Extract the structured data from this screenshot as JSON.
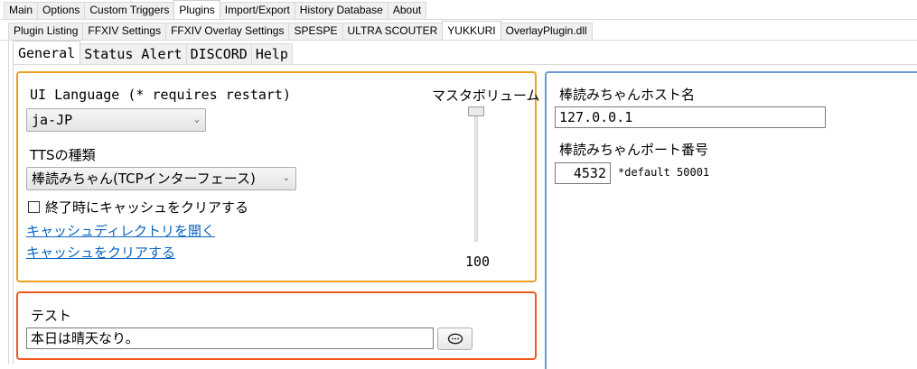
{
  "top_tabs": [
    {
      "label": "Main"
    },
    {
      "label": "Options"
    },
    {
      "label": "Custom Triggers"
    },
    {
      "label": "Plugins",
      "active": true
    },
    {
      "label": "Import/Export"
    },
    {
      "label": "History Database"
    },
    {
      "label": "About"
    }
  ],
  "plugin_tabs": [
    {
      "label": "Plugin Listing"
    },
    {
      "label": "FFXIV Settings"
    },
    {
      "label": "FFXIV Overlay Settings"
    },
    {
      "label": "SPESPE"
    },
    {
      "label": "ULTRA SCOUTER"
    },
    {
      "label": "YUKKURI",
      "active": true
    },
    {
      "label": "OverlayPlugin.dll"
    }
  ],
  "yukkuri_tabs": [
    {
      "label": "General",
      "active": true
    },
    {
      "label": "Status Alert"
    },
    {
      "label": "DISCORD"
    },
    {
      "label": "Help"
    }
  ],
  "settings": {
    "ui_language_label": "UI Language (* requires restart)",
    "ui_language_value": "ja-JP",
    "tts_label": "TTSの種類",
    "tts_value": "棒読みちゃん(TCPインターフェース)",
    "clear_cache_on_exit_label": "終了時にキャッシュをクリアする",
    "clear_cache_on_exit_checked": false,
    "open_cache_dir_link": "キャッシュディレクトリを開く",
    "clear_cache_link": "キャッシュをクリアする",
    "master_volume_label": "マスタボリューム",
    "master_volume_value": "100"
  },
  "test": {
    "label": "テスト",
    "input_value": "本日は晴天なり。"
  },
  "host": {
    "host_label": "棒読みちゃんホスト名",
    "host_value": "127.0.0.1",
    "port_label": "棒読みちゃんポート番号",
    "port_value": "4532",
    "port_default_note": "*default 50001"
  },
  "icons": {
    "speak_button_icon": "speech-bubble-icon",
    "dropdown_icon": "chevron-down-icon"
  },
  "colors": {
    "settings_border": "#f0a020",
    "test_border": "#f05a1e",
    "host_border": "#6a9ad6",
    "link": "#0a66c2"
  }
}
